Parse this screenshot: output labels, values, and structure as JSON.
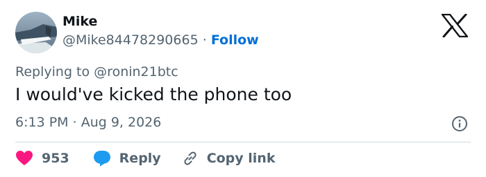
{
  "author": {
    "name": "Mike",
    "handle": "@Mike84478290665",
    "separator": "·",
    "follow_label": "Follow"
  },
  "logo_icon": "x-logo-icon",
  "replying": {
    "prefix": "Replying to",
    "target": "@ronin21btc"
  },
  "tweet": {
    "text": "I would've kicked the phone too",
    "time": "6:13 PM",
    "separator": "·",
    "date": "Aug 9, 2026"
  },
  "actions": {
    "likes_count": "953",
    "reply_label": "Reply",
    "copy_label": "Copy link"
  },
  "colors": {
    "like": "#f91880",
    "reply": "#1d9bf0",
    "link": "#006fd6",
    "secondary_text": "#536471",
    "primary_text": "#0f1419"
  }
}
